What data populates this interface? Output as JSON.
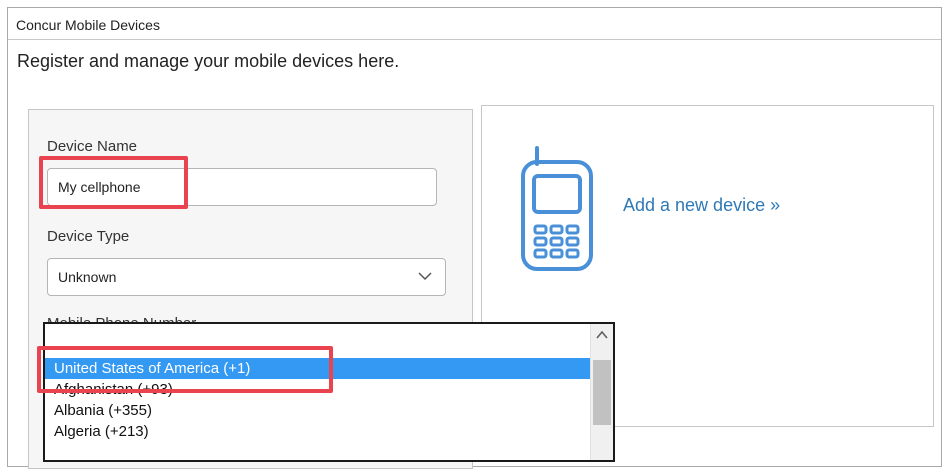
{
  "panel": {
    "title": "Concur Mobile Devices",
    "intro": "Register and manage your mobile devices here."
  },
  "form": {
    "device_name_label": "Device Name",
    "device_name_value": "My cellphone",
    "device_type_label": "Device Type",
    "device_type_value": "Unknown",
    "phone_number_label": "Mobile Phone Number"
  },
  "add_device": {
    "link_text": "Add a new device »",
    "icon": "mobile-phone-icon"
  },
  "country_dropdown": {
    "options": [
      "United States of America (+1)",
      "Afghanistan (+93)",
      "Albania (+355)",
      "Algeria (+213)"
    ],
    "selected": "United States of America (+1)"
  },
  "colors": {
    "link": "#2f79b7",
    "selected_option": "#3399f3",
    "annotation": "#e8434f",
    "icon_stroke": "#4a90d9"
  }
}
